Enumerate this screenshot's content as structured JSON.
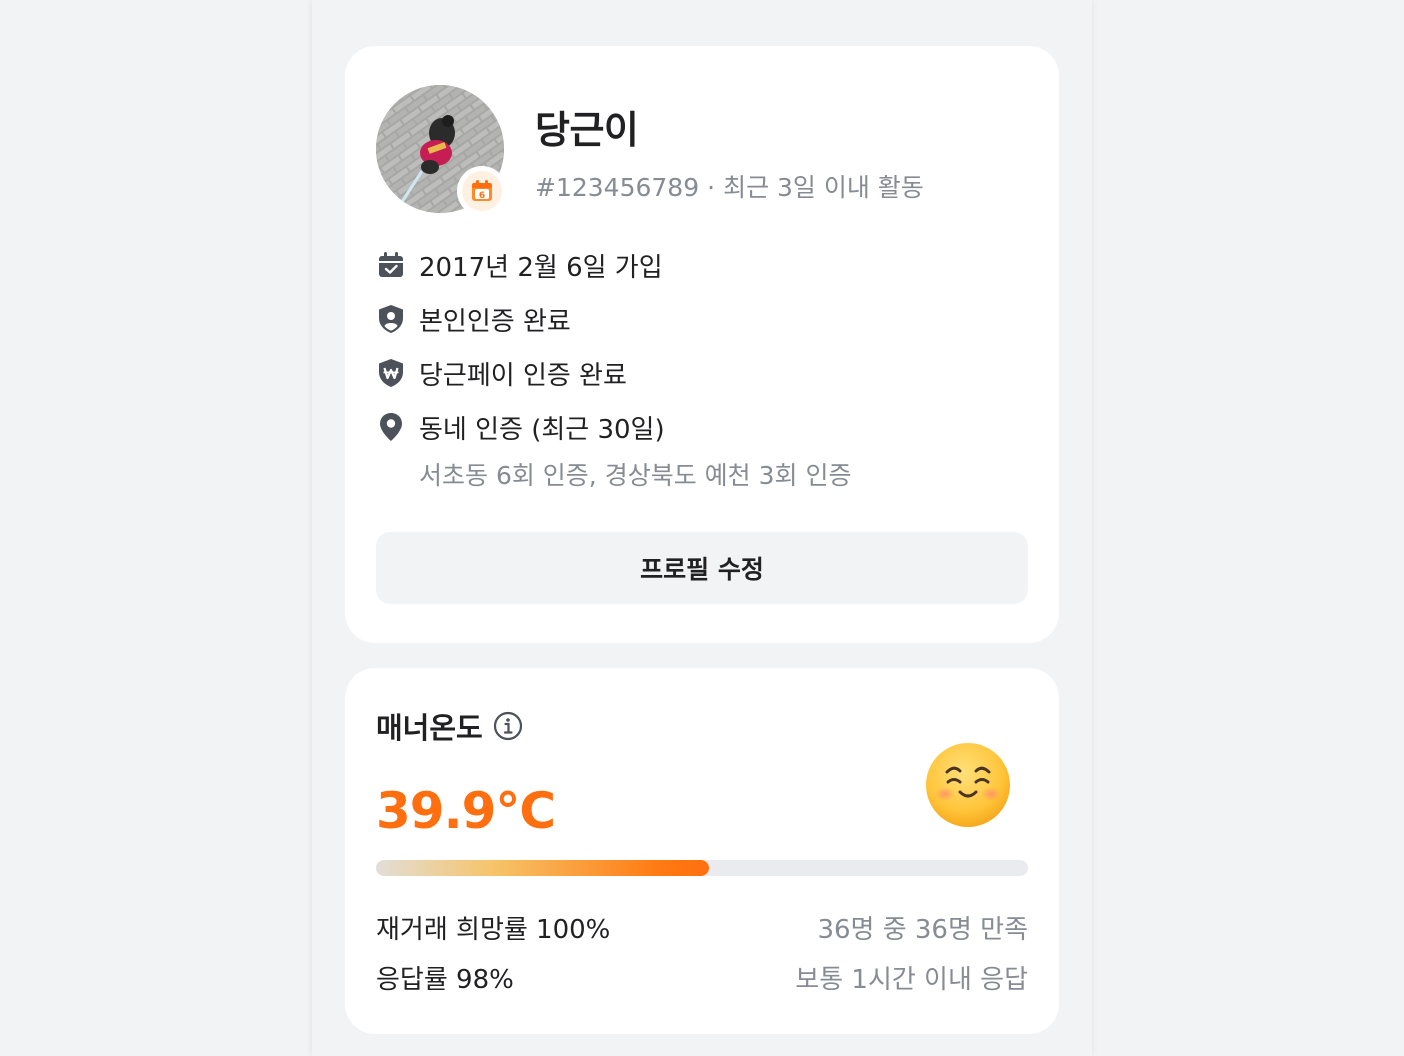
{
  "profile": {
    "nickname": "당근이",
    "user_id": "#123456789",
    "separator": "·",
    "activity": "최근 3일 이내 활동",
    "joined": "2017년 2월 6일 가입",
    "identity_verified": "본인인증 완료",
    "pay_verified": "당근페이 인증 완료",
    "neighborhood_title": "동네 인증 (최근 30일)",
    "neighborhood_detail": "서초동 6회 인증, 경상북도 예천 3회 인증",
    "edit_button": "프로필 수정",
    "badge_icon": "calendar-badge-icon"
  },
  "manner": {
    "title": "매너온도",
    "temperature": "39.9°C",
    "temperature_fill": 0.51,
    "face_icon": "smiling-face-icon",
    "rehire_label": "재거래 희망률 100%",
    "rehire_detail": "36명 중 36명 만족",
    "response_label": "응답률 98%",
    "response_detail": "보통 1시간 이내 응답"
  },
  "colors": {
    "accent": "#ff6f0f",
    "muted_text": "#868b94",
    "icon": "#4d5159",
    "background": "#f2f3f5"
  }
}
